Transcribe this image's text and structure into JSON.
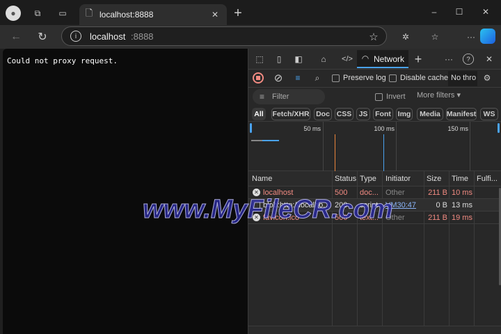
{
  "browser": {
    "tab_title": "localhost:8888",
    "address": "localhost",
    "address_port": ":8888"
  },
  "page": {
    "message": "Could not proxy request."
  },
  "devtools": {
    "active_tab": "Network",
    "preserve_log": "Preserve log",
    "disable_cache": "Disable cache",
    "throttle": "No thro",
    "filter_placeholder": "Filter",
    "invert": "Invert",
    "more_filters": "More filters",
    "type_filters": [
      "All",
      "Fetch/XHR",
      "Doc",
      "CSS",
      "JS",
      "Font",
      "Img",
      "Media",
      "Manifest",
      "WS"
    ],
    "timeline_ticks": [
      "50 ms",
      "100 ms",
      "150 ms"
    ],
    "columns": [
      "Name",
      "Status",
      "Type",
      "Initiator",
      "Size",
      "Time",
      "Fulfi..."
    ],
    "rows": [
      {
        "name": "localhost",
        "status": "500",
        "type": "doc...",
        "initiator": "Other",
        "size": "211 B",
        "time": "10 ms"
      },
      {
        "name": "blob:http://localho...",
        "status": "200",
        "type": "script",
        "initiator": "VM30:47",
        "size": "0 B",
        "time": "13 ms"
      },
      {
        "name": "favicon.ico",
        "status": "500",
        "type": "text...",
        "initiator": "Other",
        "size": "211 B",
        "time": "19 ms"
      }
    ]
  },
  "watermark": "www.MyFileCR.com"
}
